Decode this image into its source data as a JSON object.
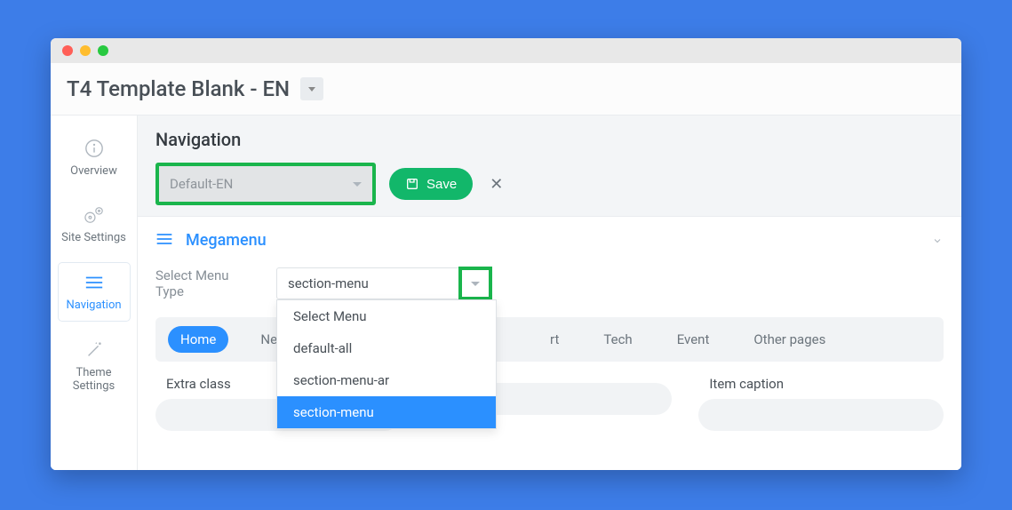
{
  "header": {
    "title": "T4 Template Blank - EN"
  },
  "sidebar": {
    "items": [
      {
        "label": "Overview",
        "icon": "info-icon"
      },
      {
        "label": "Site Settings",
        "icon": "gears-icon"
      },
      {
        "label": "Navigation",
        "icon": "menu-icon"
      },
      {
        "label": "Theme Settings",
        "icon": "wand-icon"
      }
    ]
  },
  "main": {
    "title": "Navigation",
    "layout_select": {
      "value": "Default-EN"
    },
    "save_label": "Save"
  },
  "panel": {
    "title": "Megamenu",
    "select_menu_label": "Select Menu Type",
    "menu_select": {
      "value": "section-menu",
      "options": [
        "Select Menu",
        "default-all",
        "section-menu-ar",
        "section-menu"
      ],
      "highlighted": "section-menu"
    },
    "tabs": [
      "Home",
      "News",
      "rt",
      "Tech",
      "Event",
      "Other pages"
    ],
    "active_tab": "Home",
    "fields": {
      "extra_class": {
        "label": "Extra class",
        "value": ""
      },
      "hidden_mid": {
        "label": "",
        "value": ""
      },
      "item_caption": {
        "label": "Item caption",
        "value": ""
      }
    }
  }
}
